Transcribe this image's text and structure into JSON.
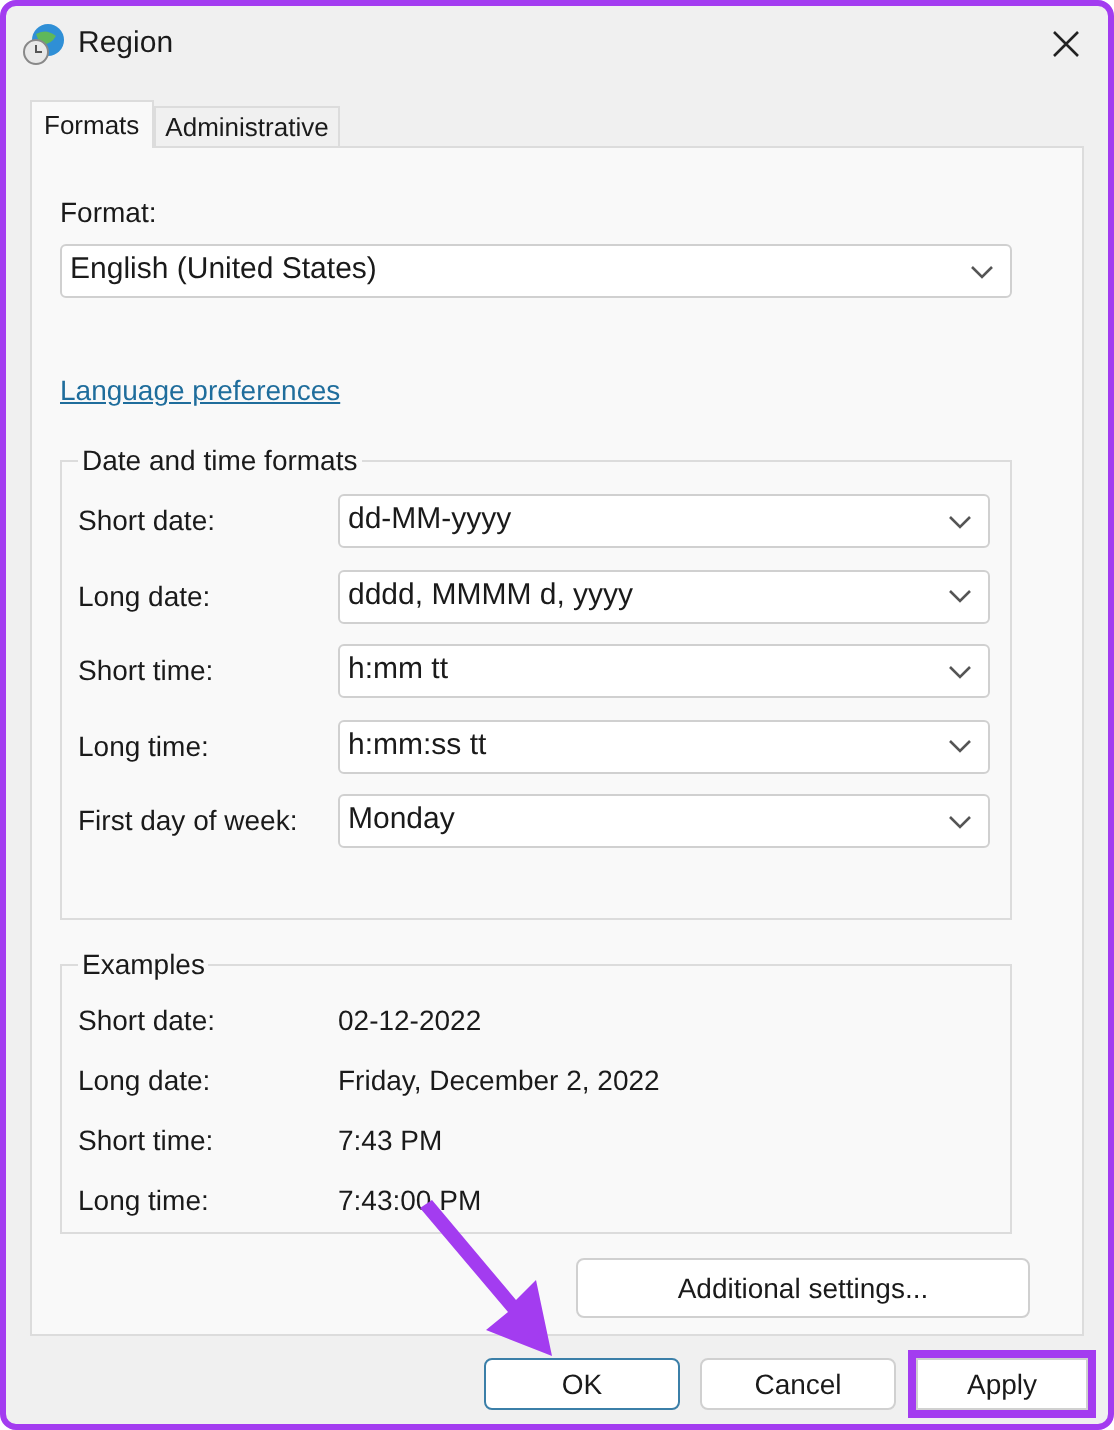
{
  "window": {
    "title": "Region"
  },
  "tabs": [
    {
      "label": "Formats",
      "selected": true
    },
    {
      "label": "Administrative",
      "selected": false
    }
  ],
  "format": {
    "label": "Format:",
    "value": "English (United States)"
  },
  "link": "Language preferences",
  "date_time_formats": {
    "title": "Date and time formats",
    "rows": [
      {
        "label": "Short date:",
        "value": "dd-MM-yyyy"
      },
      {
        "label": "Long date:",
        "value": "dddd, MMMM d, yyyy"
      },
      {
        "label": "Short time:",
        "value": "h:mm tt"
      },
      {
        "label": "Long time:",
        "value": "h:mm:ss tt"
      },
      {
        "label": "First day of week:",
        "value": "Monday"
      }
    ]
  },
  "examples": {
    "title": "Examples",
    "rows": [
      {
        "label": "Short date:",
        "value": "02-12-2022"
      },
      {
        "label": "Long date:",
        "value": "Friday, December 2, 2022"
      },
      {
        "label": "Short time:",
        "value": "7:43 PM"
      },
      {
        "label": "Long time:",
        "value": "7:43:00 PM"
      }
    ]
  },
  "additional_button": "Additional settings...",
  "buttons": [
    {
      "label": "OK",
      "focused": true,
      "highlighted": false
    },
    {
      "label": "Cancel",
      "focused": false,
      "highlighted": false
    },
    {
      "label": "Apply",
      "focused": false,
      "highlighted": true
    }
  ]
}
